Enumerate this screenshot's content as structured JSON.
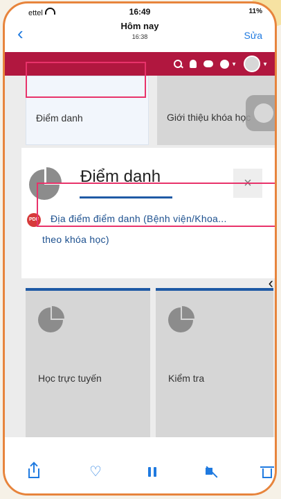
{
  "status_bar": {
    "carrier": "ettel",
    "time": "16:49",
    "battery": "11%"
  },
  "nav": {
    "back_label": "‹",
    "title": "Hôm nay",
    "subtitle": "16:38",
    "edit_label": "Sửa"
  },
  "tiles": {
    "top_left": "Điểm danh",
    "top_right": "Giới thiệu khóa học",
    "bottom_left": "Học trực tuyến",
    "bottom_right": "Kiểm tra"
  },
  "modal": {
    "title": "Điểm danh",
    "close_label": "×",
    "file_icon_text": "PDF",
    "line1": "Địa điểm điểm danh (Bệnh viện/Khoa...",
    "line2": "theo khóa học)"
  },
  "side_chevron": "‹",
  "colors": {
    "brand": "#b1173f",
    "accent": "#1f5aa5",
    "annotation": "#e8326a",
    "ios_blue": "#1f7ae0"
  }
}
